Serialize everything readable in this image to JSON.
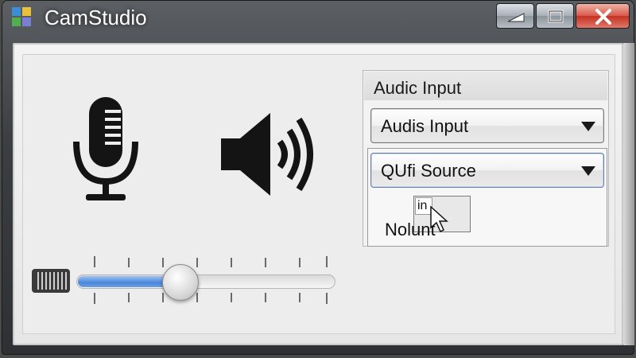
{
  "window": {
    "title": "CamStudio",
    "icon": "camstudio-app-icon"
  },
  "caption_buttons": {
    "minimize": "minimize-icon",
    "maximize": "maximize-icon",
    "close": "close-icon"
  },
  "main": {
    "microphone_icon": "microphone-icon",
    "speaker_icon": "speaker-volume-icon",
    "volume": {
      "level": 0.4
    }
  },
  "audio_panel": {
    "title": "Audic Input",
    "dropdown_input": {
      "selected": "Audis Input"
    },
    "dropdown_source": {
      "selected": "QUfi Source"
    },
    "mini_input_value": "in",
    "count_label": "Nolunt"
  },
  "colors": {
    "slider_fill": "#4a86d9",
    "close_button": "#c43221",
    "titlebar": "#3b3e42"
  }
}
